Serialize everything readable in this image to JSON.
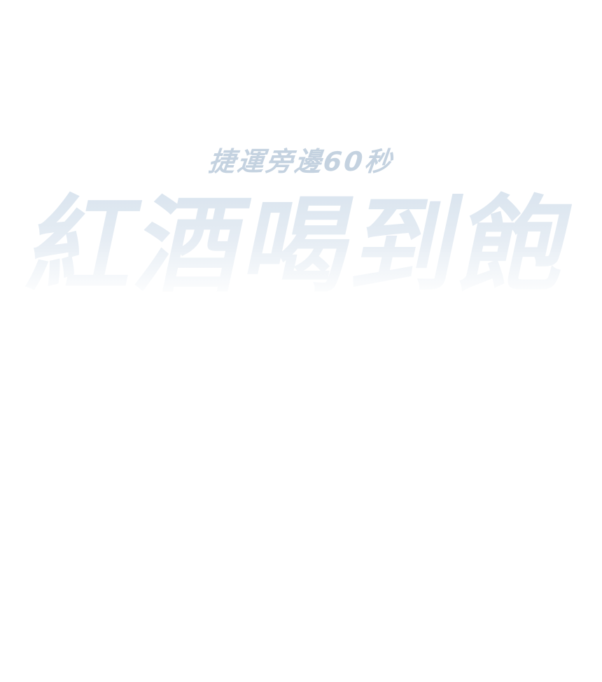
{
  "hero": {
    "subtitle": "捷運旁邊60秒",
    "headline": "紅酒喝到飽"
  },
  "colors": {
    "subtitle": "#c4d2e0",
    "headline_top": "#d8e3ee",
    "background": "#ffffff"
  }
}
